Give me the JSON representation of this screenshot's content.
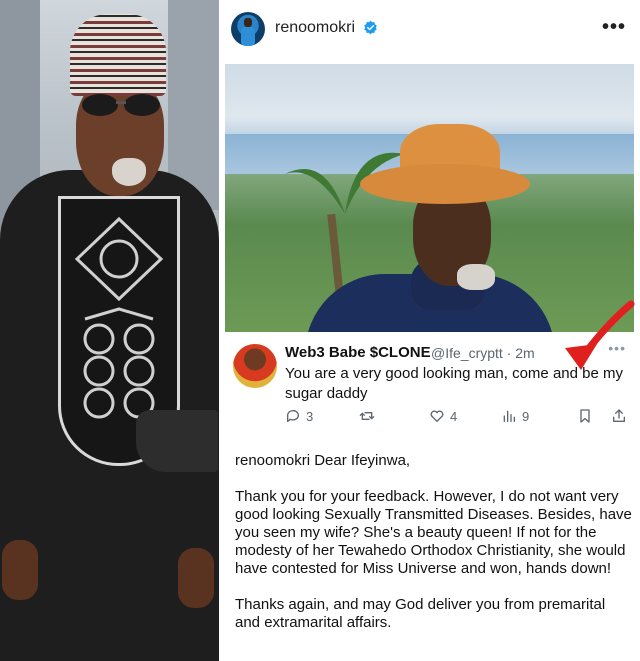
{
  "post": {
    "username": "renoomokri",
    "verified": true,
    "menu_icon": "more-horizontal-icon"
  },
  "tweet": {
    "display_name": "Web3 Babe $CLONE",
    "handle_time": "@Ife_cryptt · 2m",
    "text": "You are a very good looking man, come and be my sugar daddy",
    "actions": {
      "replies": "3",
      "retweets": "",
      "likes": "4",
      "views": "9"
    }
  },
  "caption": {
    "username": "renoomokri",
    "greeting": "Dear Ifeyinwa,",
    "paragraph1": "Thank you for your feedback. However, I do not want very good looking Sexually Transmitted Diseases. Besides, have you seen my wife? She's a beauty queen! If not for the modesty of her Tewahedo Orthodox Christianity, she would have contested for Miss Universe and won, hands down!",
    "paragraph2": "Thanks again, and may God deliver you from premarital and extramarital affairs."
  },
  "colors": {
    "verified_blue": "#1d9bf0",
    "arrow_red": "#e0201e",
    "muted_gray": "#5b6670"
  }
}
